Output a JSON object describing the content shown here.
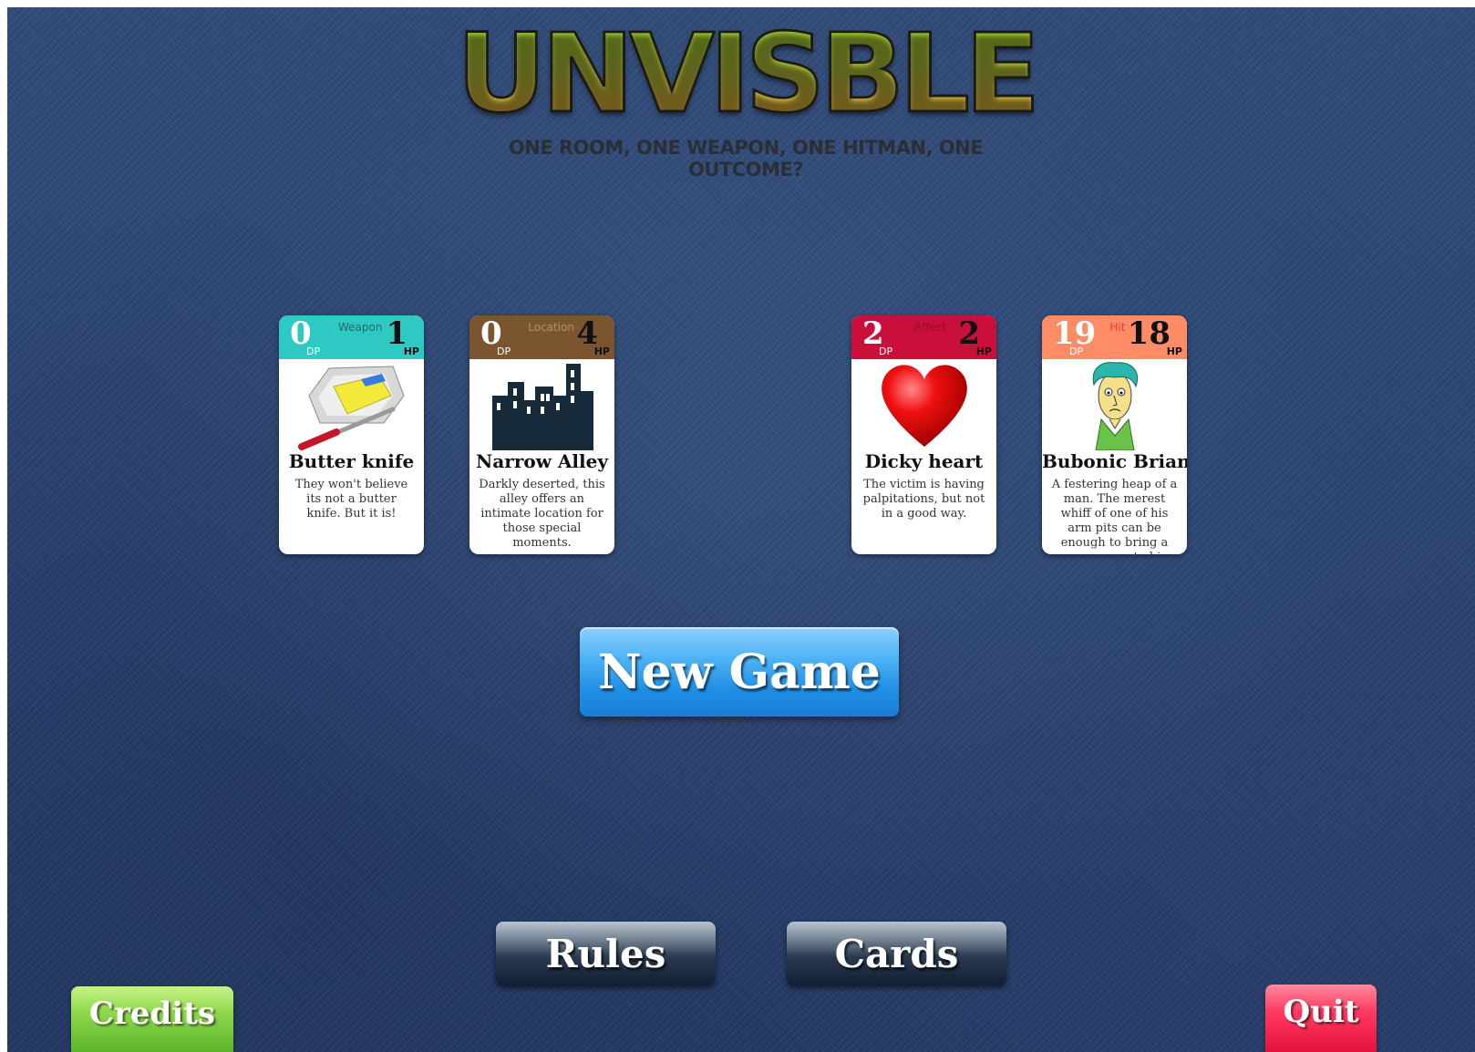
{
  "game": {
    "title": "UNVISBLE",
    "tagline": "ONE ROOM, ONE WEAPON, ONE HITMAN, ONE OUTCOME?"
  },
  "cards": [
    {
      "type": "Weapon",
      "dp": "0",
      "hp": "1",
      "dp_label": "DP",
      "hp_label": "HP",
      "name": "Butter knife",
      "description": "They won't believe its not a butter knife. But it is!",
      "color": "#2ec9c2",
      "icon": "butter-knife-icon"
    },
    {
      "type": "Location",
      "dp": "0",
      "hp": "4",
      "dp_label": "DP",
      "hp_label": "HP",
      "name": "Narrow Alley",
      "description": "Darkly deserted, this alley offers an intimate location for those special moments.",
      "color": "#7a5530",
      "icon": "city-skyline-icon"
    },
    {
      "type": "Affect",
      "dp": "2",
      "hp": "2",
      "dp_label": "DP",
      "hp_label": "HP",
      "name": "Dicky heart",
      "description": "The victim is having palpitations, but not in a good way.",
      "color": "#c8103a",
      "icon": "heart-icon"
    },
    {
      "type": "Hit",
      "dp": "19",
      "hp": "18",
      "dp_label": "DP",
      "hp_label": "HP",
      "name": "Bubonic Brian",
      "description": "A festering heap of a man. The merest whiff of one of his arm pits can be enough to bring a grown man to his knees",
      "color": "#ff8c66",
      "icon": "cartoon-man-icon"
    }
  ],
  "buttons": {
    "new_game": "New Game",
    "rules": "Rules",
    "cards": "Cards",
    "credits": "Credits",
    "quit": "Quit"
  },
  "colors": {
    "background": "#2b4573",
    "new_game": "#1f8fe6",
    "credits": "#6cc232",
    "quit": "#ff2a55"
  }
}
